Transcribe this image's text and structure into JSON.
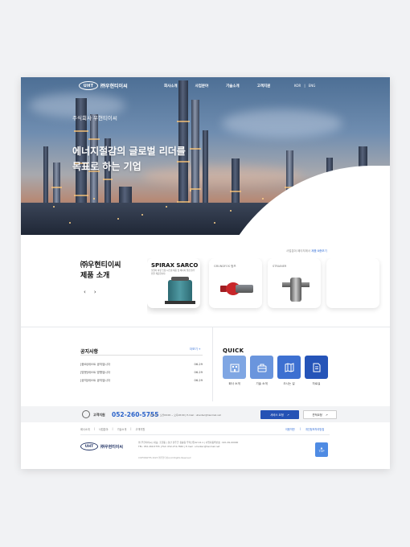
{
  "header": {
    "logo_mark": "UHT",
    "logo_name": "㈜우현티이씨",
    "menu": [
      "회사소개",
      "사업분야",
      "기술소개",
      "고객지원"
    ],
    "lang": [
      "KOR",
      "ENG"
    ]
  },
  "hero": {
    "subtitle": "주식회사 우현티이씨",
    "title_line1": "에너지절감의 글로벌 리더를",
    "title_line2": "목표로 하는 기업"
  },
  "products": {
    "title_line1": "㈜우현티이씨",
    "title_line2": "제품 소개",
    "prev": "‹",
    "next": "›",
    "link_text": "사업분야 페이지에서",
    "link_emph": "제품 8종보기",
    "cards": [
      {
        "brand": "SPIRAX SARCO",
        "desc": "보일러 하류 스팀 시스템 제품 및 에너지 절감 솔루션을 제공합니다."
      },
      {
        "caption": "GRUNDFOS 펌프"
      },
      {
        "caption": "STRAINER"
      }
    ]
  },
  "notice": {
    "title": "공지사항",
    "more": "더보기 +",
    "items": [
      {
        "title": "[중요]테스트 공지입니다",
        "date": "06-29"
      },
      {
        "title": "[방문]테스트 방명입니다",
        "date": "06-29"
      },
      {
        "title": "[공지]테스트 공지입니다",
        "date": "06-29"
      }
    ]
  },
  "quick": {
    "title": "QUICK",
    "items": [
      {
        "label": "회사 소개",
        "icon": "building-icon",
        "color": "#7fa6e3"
      },
      {
        "label": "기술 소개",
        "icon": "toolbox-icon",
        "color": "#6a95dd"
      },
      {
        "label": "오시는 길",
        "icon": "map-icon",
        "color": "#3d70d1"
      },
      {
        "label": "자료실",
        "icon": "document-icon",
        "color": "#2554b8"
      }
    ]
  },
  "contact": {
    "label": "고객지원",
    "phone": "052-260-5755",
    "info": "상담시간 : 오전09:00 ~ 오후18:00  |  E-mail : uhantec@hanmail.net",
    "btn_primary": "서비스 요청",
    "btn_secondary": "견적요청"
  },
  "footer": {
    "links": [
      "회사소개",
      "사업분야",
      "기술소개",
      "고객지원"
    ],
    "links_right": [
      "이용약관",
      "개인정보처리방침"
    ],
    "logo_mark": "UHT",
    "logo_name": "㈜우현티이씨",
    "address_line1": "㈜ 우현티이씨  |  대표: 홍길동  |  울산 울주군 청량읍 무학산길42 24-1  |  사업자등록번호 : 621-81-00000",
    "address_line2": "TEL: 052-260-5755  |  FAX: 052-274-7840  |  E-mail : uhantec@hanmail.net",
    "copyright": "COPYRIGHTS 2023 ㈜우현티이씨 All Rights Reserved",
    "top": "TOP"
  }
}
